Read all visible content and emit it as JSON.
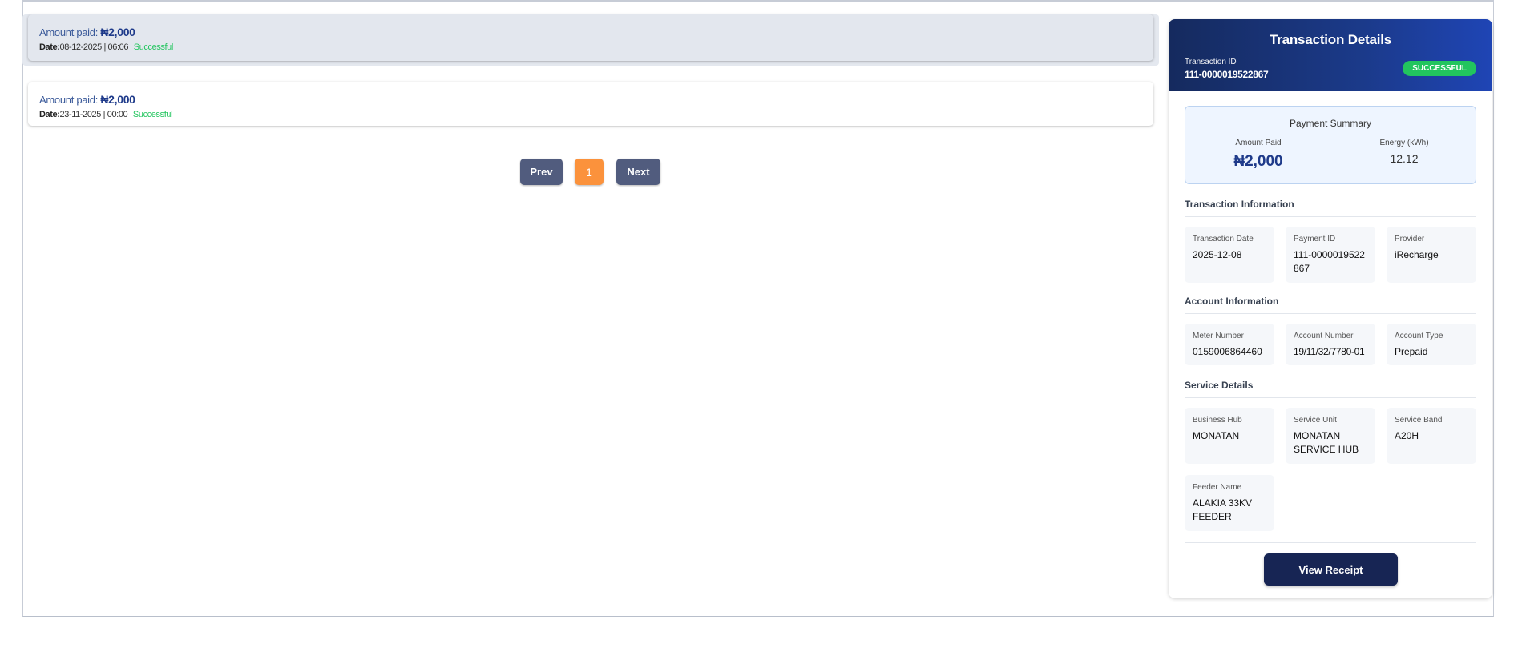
{
  "transactions": [
    {
      "amount_label": "Amount paid:",
      "amount": "₦2,000",
      "date_label": "Date:",
      "date": "08-12-2025 | 06:06",
      "status": "Successful"
    },
    {
      "amount_label": "Amount paid:",
      "amount": "₦2,000",
      "date_label": "Date:",
      "date": "23-11-2025 | 00:00",
      "status": "Successful"
    }
  ],
  "pagination": {
    "prev": "Prev",
    "current": "1",
    "next": "Next"
  },
  "details": {
    "title": "Transaction Details",
    "transaction_id_label": "Transaction ID",
    "transaction_id": "111-0000019522867",
    "status_badge": "SUCCESSFUL",
    "summary": {
      "title": "Payment Summary",
      "amount_label": "Amount Paid",
      "amount": "₦2,000",
      "energy_label": "Energy (kWh)",
      "energy": "12.12"
    },
    "transaction_info": {
      "title": "Transaction Information",
      "date_label": "Transaction Date",
      "date": "2025-12-08",
      "payment_id_label": "Payment ID",
      "payment_id": "111-0000019522867",
      "provider_label": "Provider",
      "provider": "iRecharge"
    },
    "account_info": {
      "title": "Account Information",
      "meter_label": "Meter Number",
      "meter": "0159006864460",
      "account_label": "Account Number",
      "account": "19/11/32/7780-01",
      "type_label": "Account Type",
      "type": "Prepaid"
    },
    "service": {
      "title": "Service Details",
      "hub_label": "Business Hub",
      "hub": "MONATAN",
      "unit_label": "Service Unit",
      "unit": "MONATAN SERVICE HUB",
      "band_label": "Service Band",
      "band": "A20H",
      "feeder_label": "Feeder Name",
      "feeder": "ALAKIA 33KV FEEDER"
    },
    "receipt_button": "View Receipt"
  }
}
